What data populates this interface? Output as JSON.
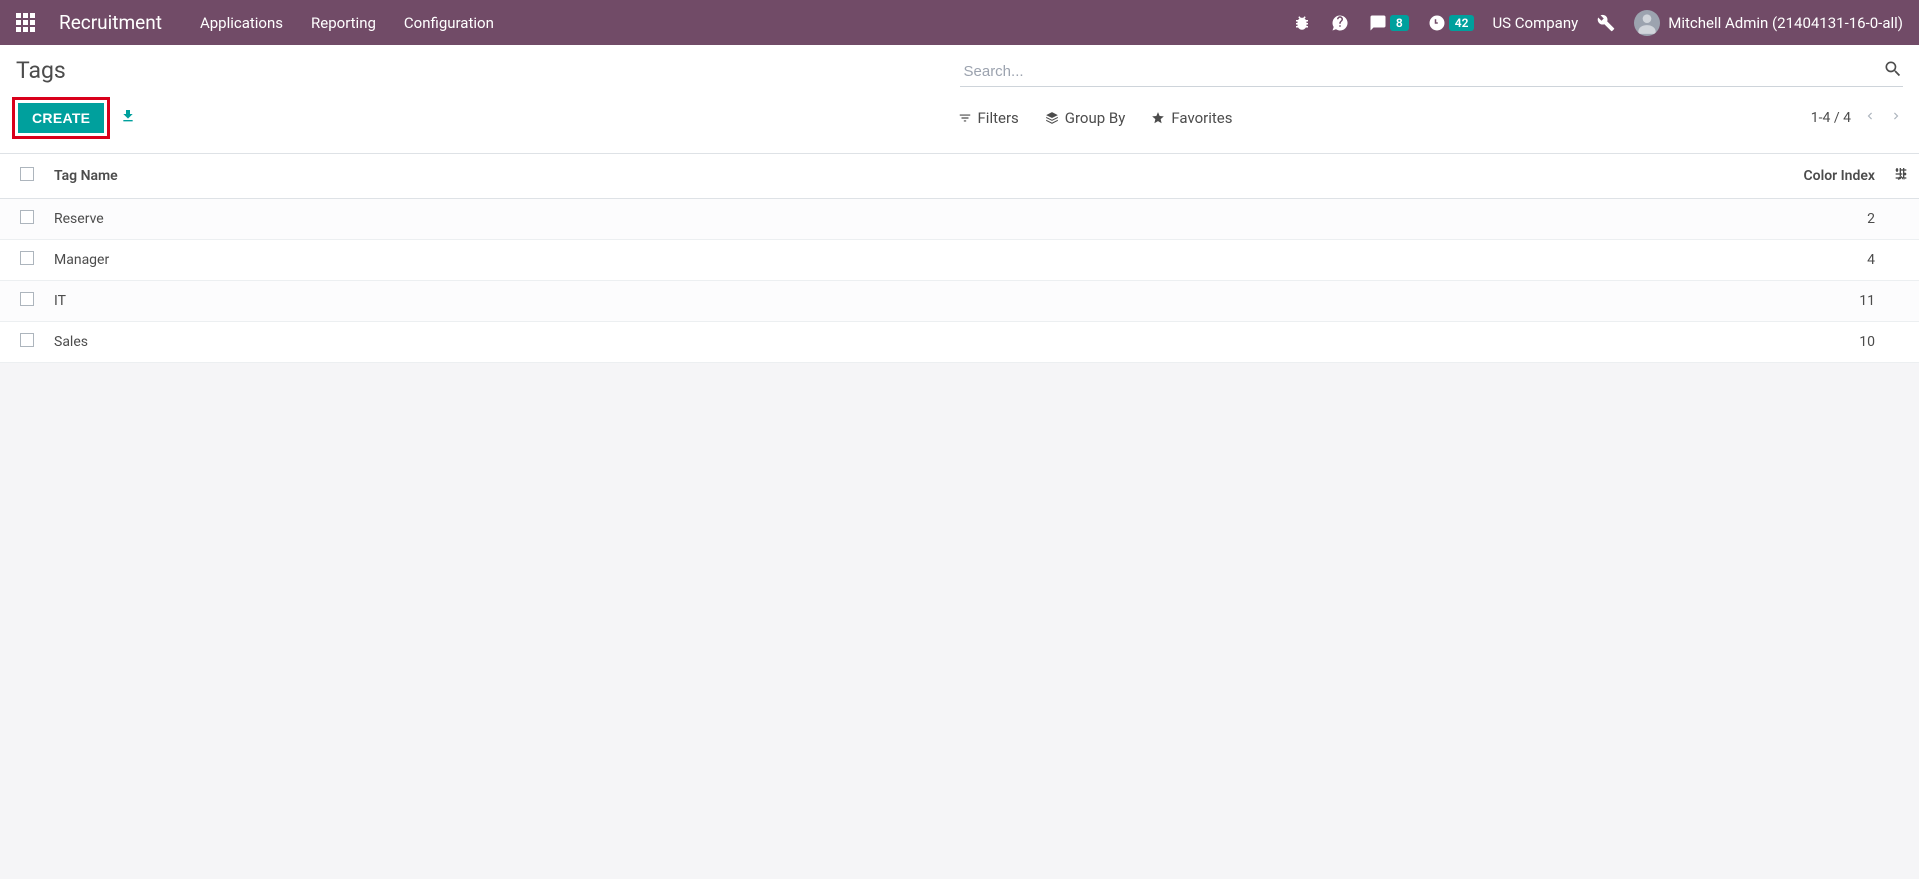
{
  "navbar": {
    "app_title": "Recruitment",
    "menu": [
      "Applications",
      "Reporting",
      "Configuration"
    ],
    "messages_badge": "8",
    "activities_badge": "42",
    "company": "US Company",
    "user": "Mitchell Admin (21404131-16-0-all)"
  },
  "control": {
    "page_title": "Tags",
    "search_placeholder": "Search...",
    "create_label": "CREATE",
    "filters_label": "Filters",
    "groupby_label": "Group By",
    "favorites_label": "Favorites",
    "pager_range": "1-4 / 4"
  },
  "table": {
    "col_name": "Tag Name",
    "col_color": "Color Index",
    "rows": [
      {
        "name": "Reserve",
        "color": "2"
      },
      {
        "name": "Manager",
        "color": "4"
      },
      {
        "name": "IT",
        "color": "11"
      },
      {
        "name": "Sales",
        "color": "10"
      }
    ]
  }
}
